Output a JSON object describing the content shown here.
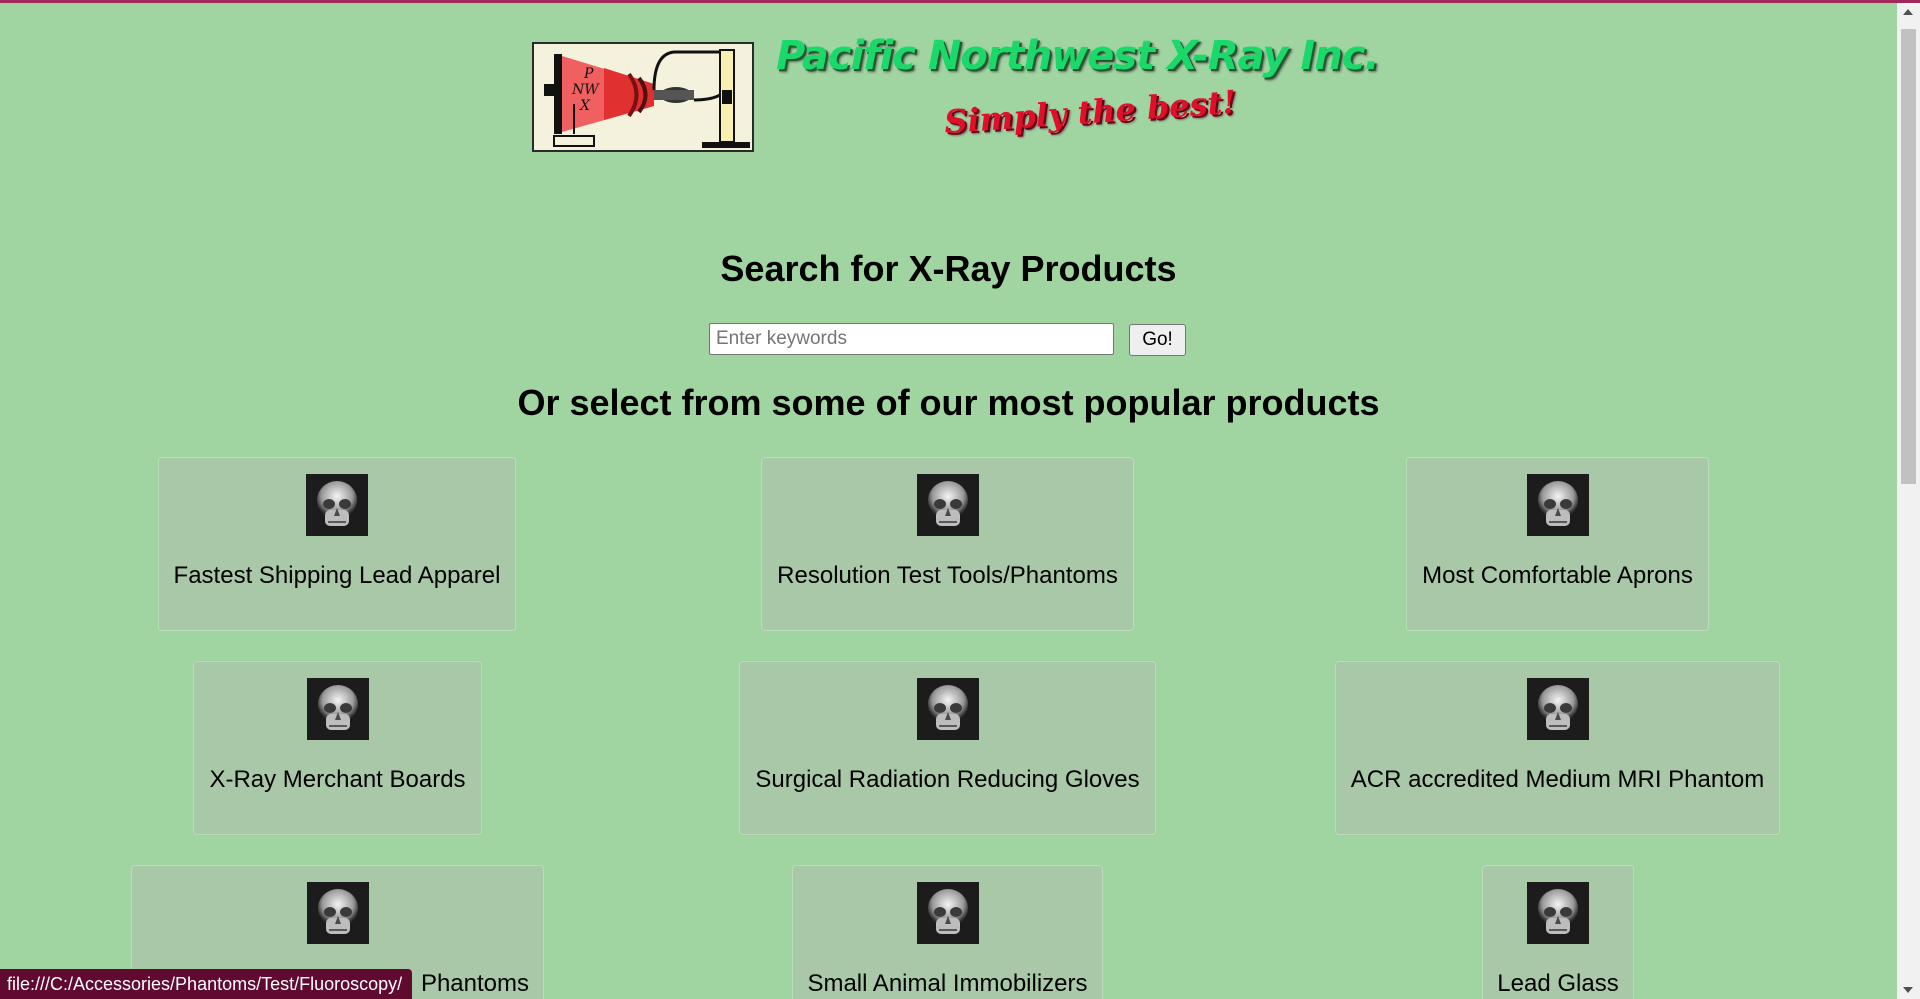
{
  "header": {
    "logo_letters": "P NW X",
    "brand_name": "Pacific Northwest X-Ray Inc.",
    "tagline": "Simply the best!"
  },
  "search": {
    "heading": "Search for X-Ray Products",
    "placeholder": "Enter keywords",
    "value": "",
    "button_label": "Go!"
  },
  "popular": {
    "heading": "Or select from some of our most popular products",
    "products": [
      {
        "label": "Fastest Shipping Lead Apparel",
        "icon": "skull-xray-icon"
      },
      {
        "label": "Resolution Test Tools/Phantoms",
        "icon": "skull-xray-icon"
      },
      {
        "label": "Most Comfortable Aprons",
        "icon": "skull-xray-icon"
      },
      {
        "label": "X-Ray Merchant Boards",
        "icon": "skull-xray-icon"
      },
      {
        "label": "Surgical Radiation Reducing Gloves",
        "icon": "skull-xray-icon"
      },
      {
        "label": "ACR accredited Medium MRI Phantom",
        "icon": "skull-xray-icon"
      },
      {
        "label": "Phantoms",
        "icon": "skull-xray-icon"
      },
      {
        "label": "Small Animal Immobilizers",
        "icon": "skull-xray-icon"
      },
      {
        "label": "Lead Glass",
        "icon": "skull-xray-icon"
      }
    ]
  },
  "status_bar": {
    "url": "file:///C:/Accessories/Phantoms/Test/Fluoroscopy/"
  },
  "colors": {
    "page_background": "#a0d4a0",
    "card_background": "#a8c8a8",
    "brand_green": "#1bd86a",
    "tagline_red": "#e0102a",
    "top_accent": "#a0285a",
    "status_bar": "#5f0a2e"
  }
}
